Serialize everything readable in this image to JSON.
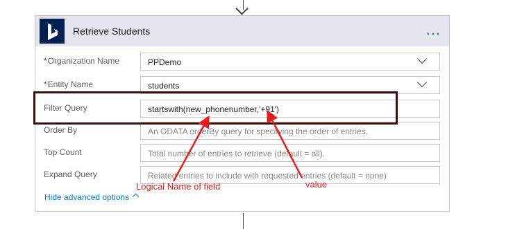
{
  "card": {
    "title": "Retrieve Students",
    "more_label": "..."
  },
  "fields": [
    {
      "label": "Organization Name",
      "required": true,
      "value": "PPDemo",
      "placeholder": "",
      "dropdown": true
    },
    {
      "label": "Entity Name",
      "required": true,
      "value": "students",
      "placeholder": "",
      "dropdown": true
    },
    {
      "label": "Filter Query",
      "required": false,
      "value": "startswith(new_phonenumber,'+91')",
      "placeholder": "",
      "dropdown": false
    },
    {
      "label": "Order By",
      "required": false,
      "value": "",
      "placeholder": "An ODATA orderBy query for specifying the order of entries.",
      "dropdown": false
    },
    {
      "label": "Top Count",
      "required": false,
      "value": "",
      "placeholder": "Total number of entries to retrieve (default = all).",
      "dropdown": false
    },
    {
      "label": "Expand Query",
      "required": false,
      "value": "",
      "placeholder": "Related entries to include with requested entries (default = none)",
      "dropdown": false
    }
  ],
  "required_marker": "*",
  "advanced_link": "Hide advanced options",
  "annotations": {
    "logical_name": "Logical Name of field",
    "value": "value"
  },
  "colors": {
    "accent": "#0078d4",
    "header_bg": "#e5e5ef",
    "icon_bg": "#002050",
    "annotation_red": "#e81c1c",
    "highlight_border": "#3c0f0f"
  }
}
